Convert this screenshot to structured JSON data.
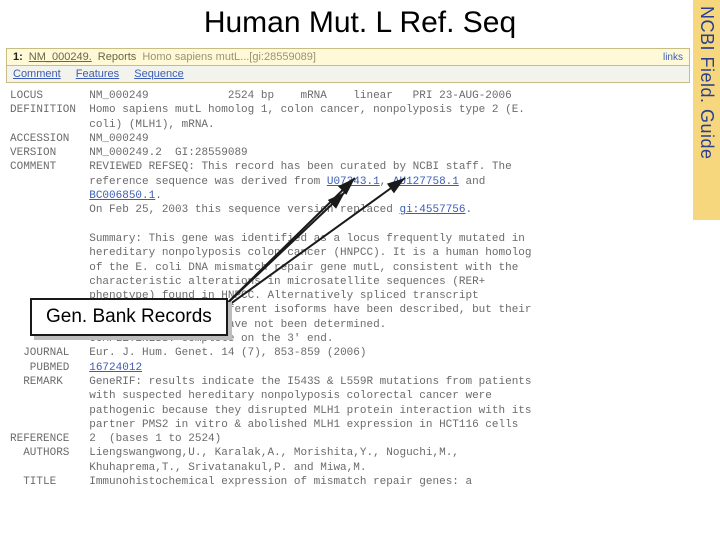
{
  "heading": "Human Mut. L Ref. Seq",
  "side_label": "NCBI Field. Guide",
  "summary_bar": {
    "index": "1:",
    "accession": "NM_000249.",
    "reports": "Reports",
    "title": "Homo sapiens mutL...[gi:28559089]",
    "links": "Links"
  },
  "tabs": {
    "comment": "Comment",
    "features": "Features",
    "sequence": "Sequence"
  },
  "flat": {
    "locus_key": "LOCUS",
    "locus_val": "NM_000249            2524 bp    mRNA    linear   PRI 23-AUG-2006",
    "definition_key": "DEFINITION",
    "definition_val1": "Homo sapiens mutL homolog 1, colon cancer, nonpolyposis type 2 (E.",
    "definition_val2": "coli) (MLH1), mRNA.",
    "accession_key": "ACCESSION",
    "accession_val": "NM_000249",
    "version_key": "VERSION",
    "version_val": "NM_000249.2  GI:28559089",
    "comment_key": "COMMENT",
    "comment_ln1a": "REVIEWED REFSEQ: This record has been curated by NCBI staff. The",
    "comment_ln2a": "reference sequence was derived from ",
    "comment_link_u07343": "U07343.1",
    "comment_sep1": ", ",
    "comment_link_au127758": "AU127758.1",
    "comment_ln2b": " and",
    "comment_link_bc006850": "BC006850.1",
    "comment_dot": ".",
    "comment_ln4a": "On Feb 25, 2003 this sequence version replaced ",
    "comment_link_gi": "gi:4557756",
    "comment_ln4b": ".",
    "summary_ln1": "Summary: This gene was identified as a locus frequently mutated in",
    "summary_ln2": "hereditary nonpolyposis colon cancer (HNPCC). It is a human homolog",
    "summary_ln3a": "of the E. coli DNA mismatch repair gene mutL, consistent with the",
    "summary_ln4": "characteristic alterations in microsatellite sequences (RER+",
    "summary_ln5": "phenotype) found in HNPCC. Alternatively spliced transcript",
    "summary_ln6": "variants encoding different isoforms have been described, but their",
    "summary_ln7": "full-length natures have not been determined.",
    "completeness": "COMPLETENESS: complete on the 3' end.",
    "journal_key": "  JOURNAL",
    "journal_val": "Eur. J. Hum. Genet. 14 (7), 853-859 (2006)",
    "pubmed_key": "   PUBMED",
    "pubmed_link": "16724012",
    "remark_key": "  REMARK",
    "remark_ln1": "GeneRIF: results indicate the I543S & L559R mutations from patients",
    "remark_ln2": "with suspected hereditary nonpolyposis colorectal cancer were",
    "remark_ln3": "pathogenic because they disrupted MLH1 protein interaction with its",
    "remark_ln4": "partner PMS2 in vitro & abolished MLH1 expression in HCT116 cells",
    "reference_key": "REFERENCE",
    "reference_val": "2  (bases 1 to 2524)",
    "authors_key": "  AUTHORS",
    "authors_ln1": "Liengswangwong,U., Karalak,A., Morishita,Y., Noguchi,M.,",
    "authors_ln2": "Khuhaprema,T., Srivatanakul,P. and Miwa,M.",
    "title_key": "  TITLE",
    "title_val": "Immunohistochemical expression of mismatch repair genes: a"
  },
  "genbank_label": "Gen. Bank Records"
}
